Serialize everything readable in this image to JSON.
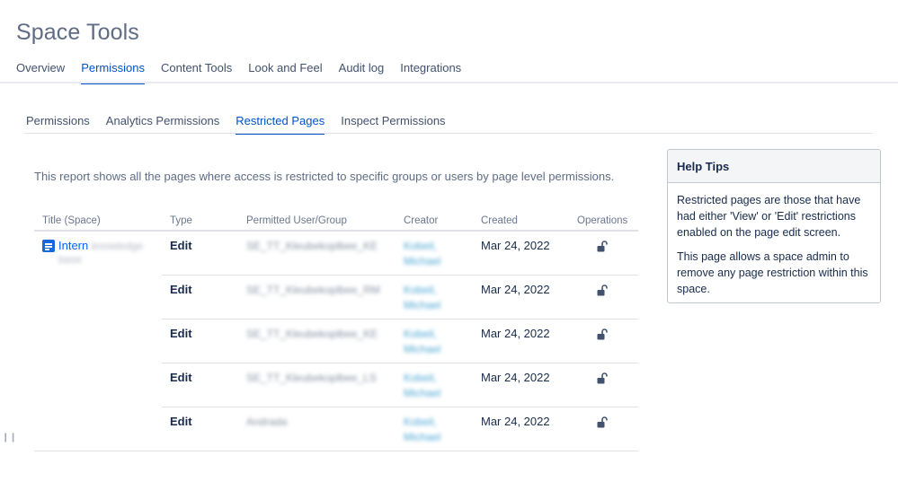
{
  "header": {
    "title": "Space Tools"
  },
  "top_tabs": [
    {
      "label": "Overview",
      "active": false
    },
    {
      "label": "Permissions",
      "active": true
    },
    {
      "label": "Content Tools",
      "active": false
    },
    {
      "label": "Look and Feel",
      "active": false
    },
    {
      "label": "Audit log",
      "active": false
    },
    {
      "label": "Integrations",
      "active": false
    }
  ],
  "sub_tabs": [
    {
      "label": "Permissions",
      "active": false
    },
    {
      "label": "Analytics Permissions",
      "active": false
    },
    {
      "label": "Restricted Pages",
      "active": true
    },
    {
      "label": "Inspect Permissions",
      "active": false
    }
  ],
  "report": {
    "description": "This report shows all the pages where access is restricted to specific groups or users by page level permissions.",
    "columns": [
      "Title (Space)",
      "Type",
      "Permitted User/Group",
      "Creator",
      "Created",
      "Operations"
    ],
    "page": {
      "name": "Intern",
      "name_blurred": "knowledge",
      "space_blurred": "base"
    },
    "rows": [
      {
        "type": "Edit",
        "permitted": "SE_TT_Kleubekoplbee_KE",
        "creator": "Kobeil, Michael",
        "created": "Mar 24, 2022"
      },
      {
        "type": "Edit",
        "permitted": "SE_TT_Kleubekoplbee_RM",
        "creator": "Kobeil, Michael",
        "created": "Mar 24, 2022"
      },
      {
        "type": "Edit",
        "permitted": "SE_TT_Kleubekoplbee_KE",
        "creator": "Kobeil, Michael",
        "created": "Mar 24, 2022"
      },
      {
        "type": "Edit",
        "permitted": "SE_TT_Kleubekoplbee_LS",
        "creator": "Kobeil, Michael",
        "created": "Mar 24, 2022"
      },
      {
        "type": "Edit",
        "permitted": "Andrada",
        "creator": "Kobeil, Michael",
        "created": "Mar 24, 2022"
      }
    ]
  },
  "help": {
    "title": "Help Tips",
    "p1": "Restricted pages are those that have had either 'View' or 'Edit' restrictions enabled on the page edit screen.",
    "p2": "This page allows a space admin to remove any page restriction within this space."
  },
  "icons": {
    "page": "page-icon",
    "unlock": "unlock-icon",
    "grip": "resize-grip-icon"
  },
  "colors": {
    "accent": "#0052cc",
    "link": "#0065ff",
    "page_icon": "#1868db"
  }
}
